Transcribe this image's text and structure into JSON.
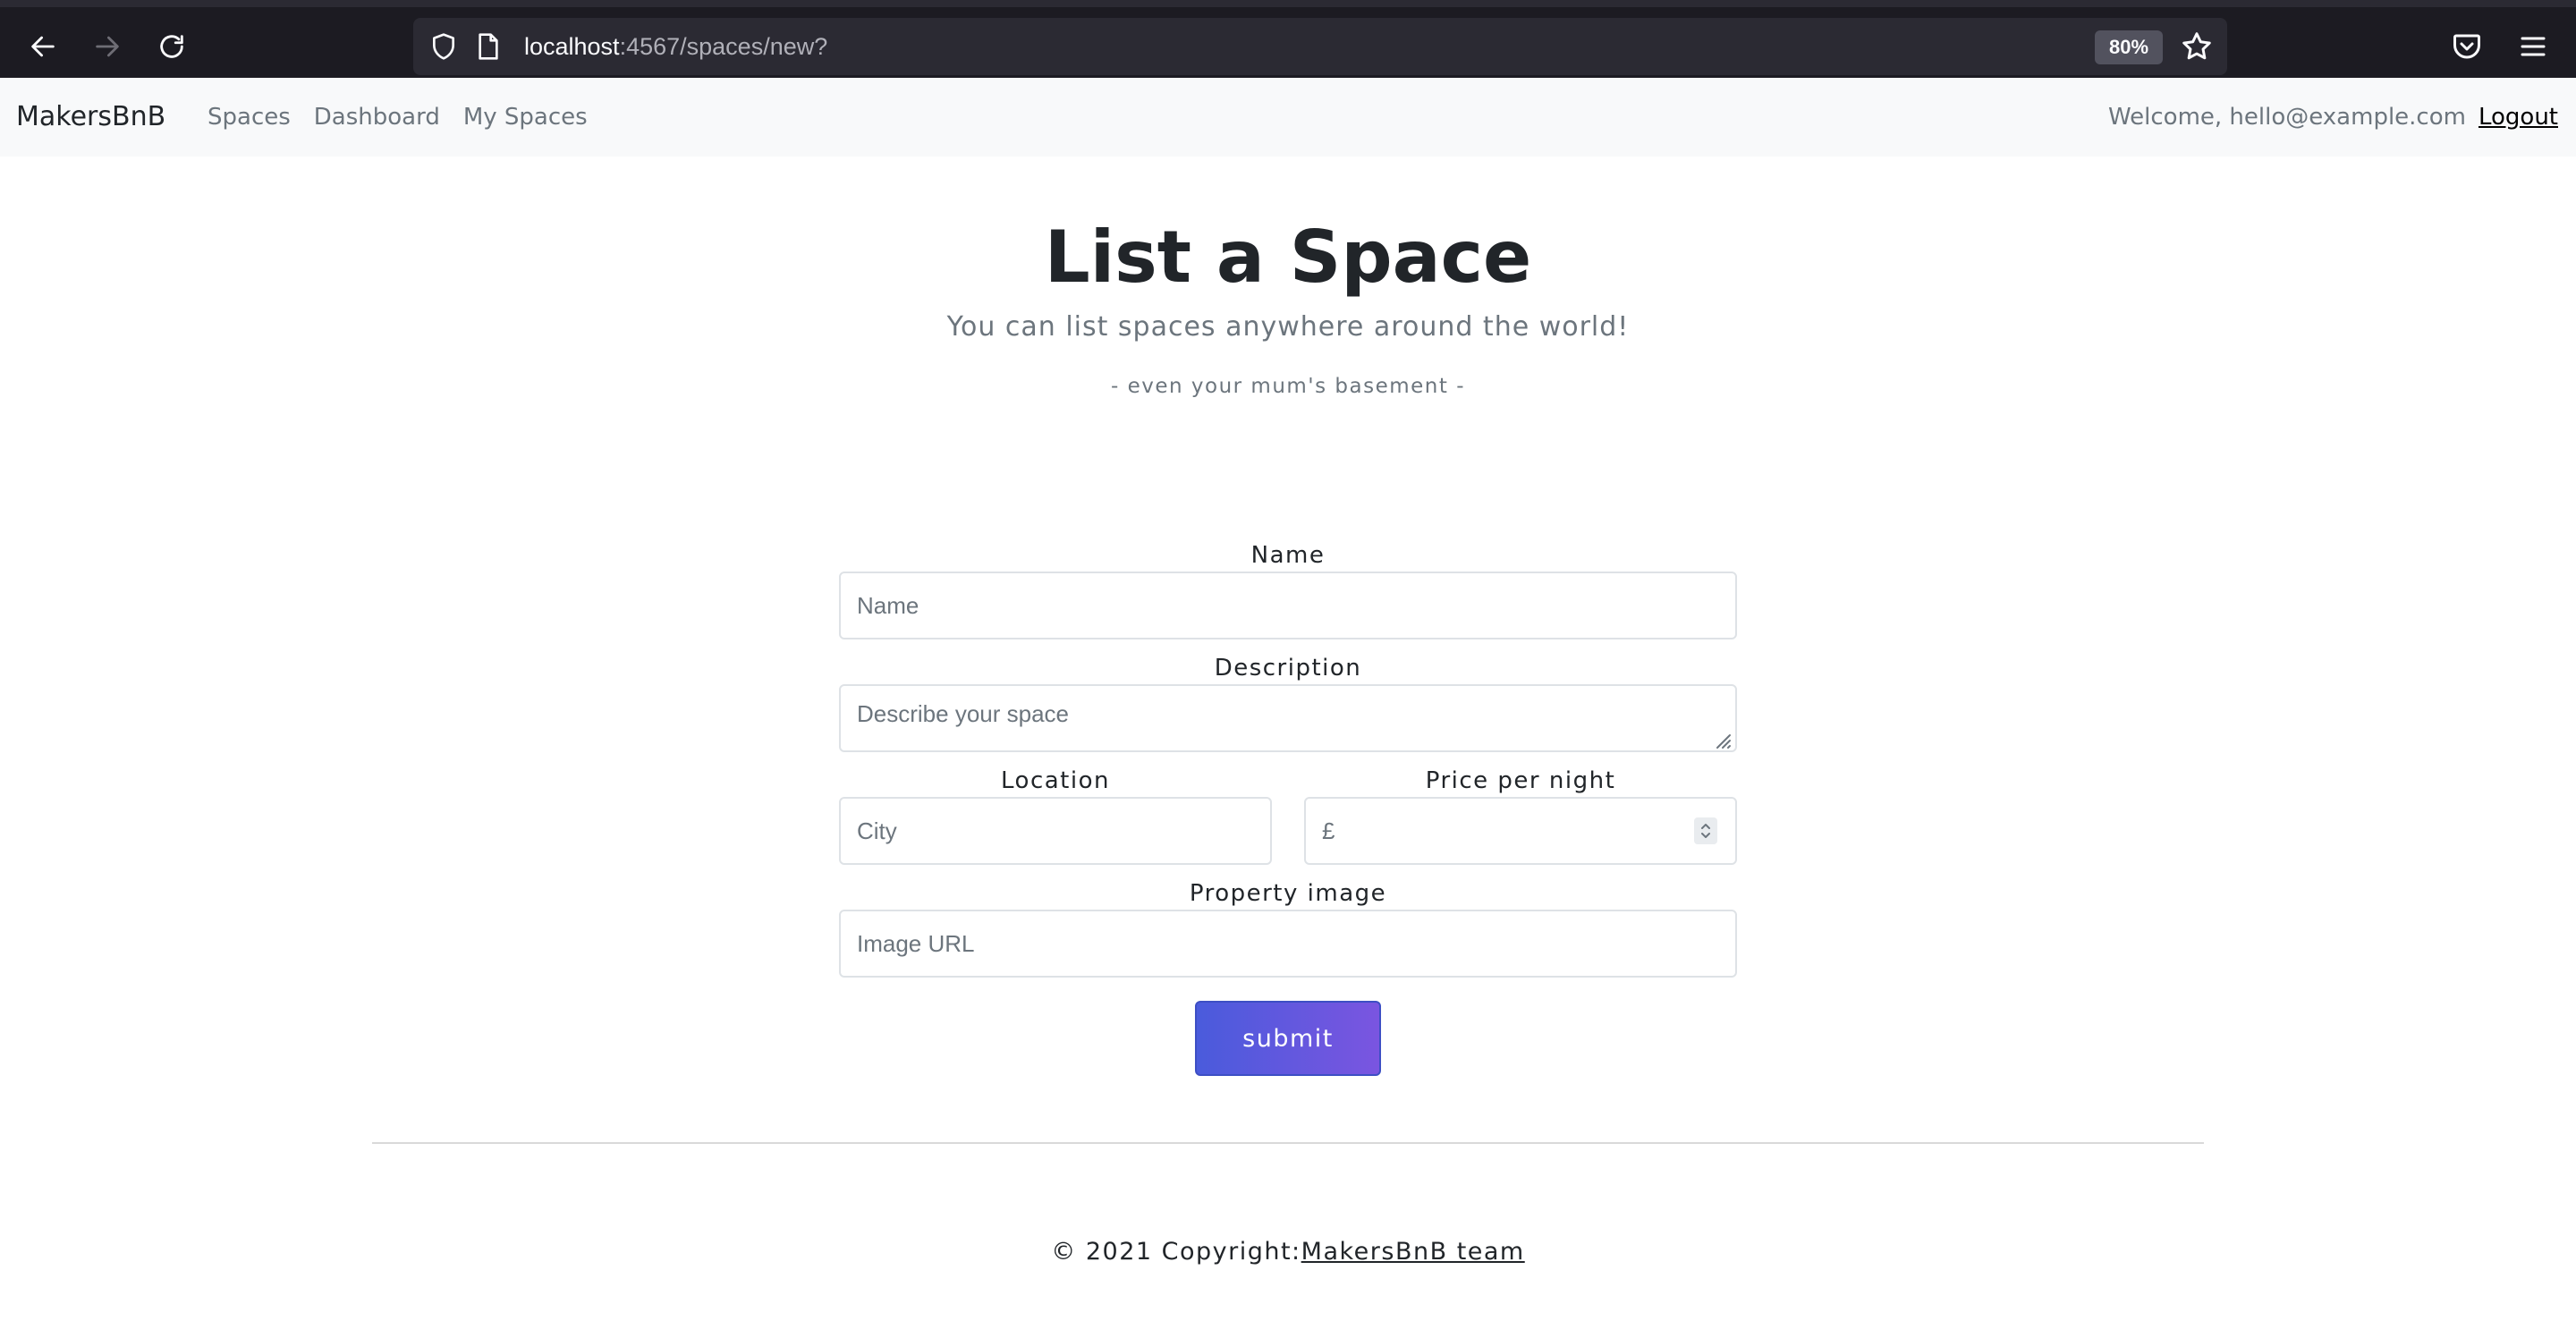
{
  "browser": {
    "url_host": "localhost",
    "url_path": ":4567/spaces/new?",
    "zoom": "80%"
  },
  "navbar": {
    "brand": "MakersBnB",
    "links": [
      "Spaces",
      "Dashboard",
      "My Spaces"
    ],
    "welcome": "Welcome, hello@example.com",
    "logout": "Logout"
  },
  "header": {
    "title": "List a Space",
    "lead": "You can list spaces anywhere around the world!",
    "tagline": "- even your mum's basement -"
  },
  "form": {
    "name_label": "Name",
    "name_placeholder": "Name",
    "description_label": "Description",
    "description_placeholder": "Describe your space",
    "location_label": "Location",
    "location_placeholder": "City",
    "price_label": "Price per night",
    "price_placeholder": "£",
    "image_label": "Property image",
    "image_placeholder": "Image URL",
    "submit_label": "submit"
  },
  "footer": {
    "copyright": "© 2021 Copyright:",
    "team_link": "MakersBnB team"
  }
}
